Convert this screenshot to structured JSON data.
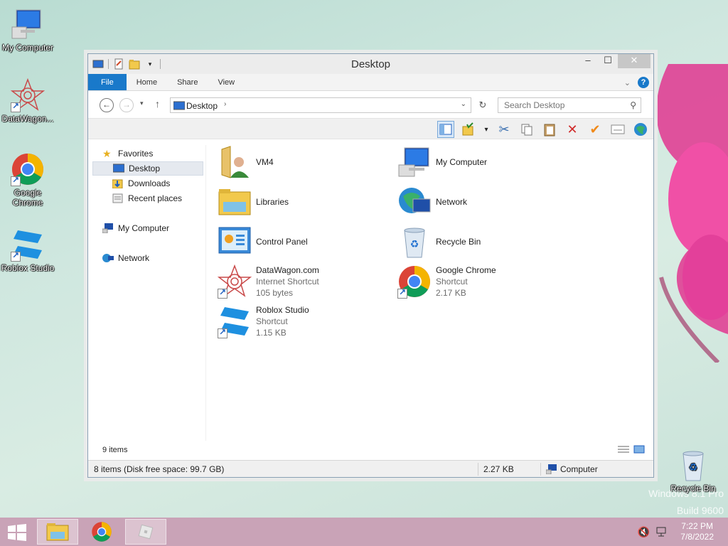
{
  "desktop": {
    "icons": [
      {
        "label": "My Computer"
      },
      {
        "label": "DataWagon..."
      },
      {
        "label": "Google Chrome"
      },
      {
        "label": "Roblox Studio"
      },
      {
        "label": "Recycle Bin"
      }
    ],
    "watermark_line1": "Windows 8.1 Pro",
    "watermark_line2": "Build 9600"
  },
  "window": {
    "title": "Desktop",
    "tabs": [
      "File",
      "Home",
      "Share",
      "View"
    ],
    "address": "Desktop",
    "search_placeholder": "Search Desktop"
  },
  "nav_pane": {
    "favorites": "Favorites",
    "desktop": "Desktop",
    "downloads": "Downloads",
    "recent": "Recent places",
    "computer": "My Computer",
    "network": "Network"
  },
  "items": [
    {
      "name": "VM4"
    },
    {
      "name": "My Computer"
    },
    {
      "name": "Libraries"
    },
    {
      "name": "Network"
    },
    {
      "name": "Control Panel"
    },
    {
      "name": "Recycle Bin"
    },
    {
      "name": "DataWagon.com",
      "type": "Internet Shortcut",
      "size": "105 bytes"
    },
    {
      "name": "Google Chrome",
      "type": "Shortcut",
      "size": "2.17 KB"
    },
    {
      "name": "Roblox Studio",
      "type": "Shortcut",
      "size": "1.15 KB"
    }
  ],
  "status": {
    "item_count": "9 items",
    "left": "8 items (Disk free space: 99.7 GB)",
    "size": "2.27 KB",
    "location": "Computer"
  },
  "taskbar": {
    "time": "7:22 PM",
    "date": "7/8/2022"
  },
  "colors": {
    "accent": "#1979ca",
    "taskbar": "#c9a3b7"
  }
}
